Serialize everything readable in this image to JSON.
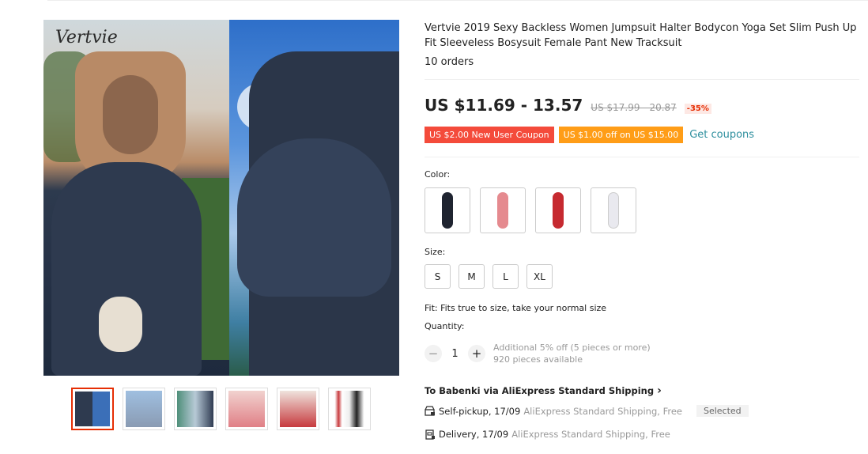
{
  "gallery": {
    "brand_watermark": "Vertvie",
    "thumbnail_names": [
      "thumb-1",
      "thumb-2",
      "thumb-3",
      "thumb-4",
      "thumb-5",
      "thumb-6"
    ]
  },
  "product": {
    "title": "Vertvie 2019 Sexy Backless Women Jumpsuit Halter Bodycon Yoga Set Slim Push Up Fit Sleeveless Bosysuit Female Pant New Tracksuit",
    "orders": "10 orders"
  },
  "price": {
    "current": "US $11.69 - 13.57",
    "original": "US $17.99 - 20.87",
    "discount": "-35%"
  },
  "coupons": {
    "new_user": "US $2.00 New User Coupon",
    "store": "US $1.00 off on US $15.00",
    "get_link": "Get coupons"
  },
  "color": {
    "label": "Color:",
    "options": [
      "#1f2430",
      "#e58a8f",
      "#c62a30",
      "#e9e9ef"
    ]
  },
  "size": {
    "label": "Size:",
    "options": [
      "S",
      "M",
      "L",
      "XL"
    ]
  },
  "fit": "Fit: Fits true to size, take your normal size",
  "quantity": {
    "label": "Quantity:",
    "value": "1",
    "minus": "−",
    "plus": "+",
    "note1": "Additional 5% off (5 pieces or more)",
    "note2": "920 pieces available"
  },
  "shipping": {
    "to_prefix": "To ",
    "to_name": "Babenki",
    "via": " via AliExpress Standard Shipping",
    "chevron": "›",
    "pickup_main": "Self-pickup, 17/09",
    "pickup_detail": "AliExpress Standard Shipping, Free",
    "selected": "Selected",
    "delivery_main": "Delivery, 17/09",
    "delivery_detail": "AliExpress Standard Shipping, Free"
  },
  "colors": {
    "accent_red": "#e62e04",
    "coupon_red": "#f44b3b",
    "coupon_orange": "#ff9d17",
    "link_teal": "#2e8f9e"
  }
}
